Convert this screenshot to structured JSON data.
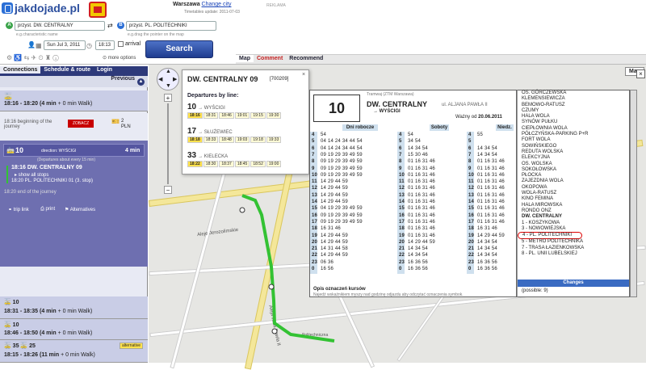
{
  "header": {
    "logo": "jakdojade.pl",
    "city_label": "Warszawa",
    "city_link": "Change city",
    "timetable_update": "Timetables update: 2011-07-03",
    "reklama": "REKLAMA",
    "from_value": "przyst. DW. CENTRALNY",
    "from_hint": "e.g.characteristic name",
    "to_value": "przyst. PL. POLITECHNIKI",
    "to_hint": "e.g.drag the pointer on the map",
    "date": "Sun Jul 3, 2011",
    "time": "18:13",
    "arrival": "arrival",
    "more_options": "more options",
    "search": "Search"
  },
  "mapbar": {
    "tabs": [
      "Map",
      "Comment",
      "Recommend"
    ],
    "map_btn": "Map"
  },
  "sidebar": {
    "tabs": [
      "Connections",
      "Schedule & route",
      "Login"
    ],
    "previous": "Previous",
    "first": {
      "time": "18:16 - 18:20",
      "dur": "(4 min",
      "walk": "+ 0 min Walk)"
    },
    "begin": "18:16 beginning of the journey",
    "badge": "ZOBACZ",
    "price": "2",
    "currency": "PLN",
    "line": "10",
    "direction": "direction: WYŚCIGI",
    "freq": "(Departures about every 15 min)",
    "dur": "4 min",
    "stop1": "18:16 DW. CENTRALNY 09",
    "show_stops": "show all stops",
    "stop2": "18:20 PL. POLITECHNIKI 01 (3. stop)",
    "end": "18:20 end of the journey",
    "trip_link": "trip link",
    "print": "print",
    "alternatives": "Alternatives",
    "alts": [
      {
        "line": "10",
        "time": "18:31 - 18:35",
        "dur": "(4 min",
        "walk": "+ 0 min Walk)"
      },
      {
        "line": "10",
        "time": "18:46 - 18:50",
        "dur": "(4 min",
        "walk": "+ 0 min Walk)"
      },
      {
        "line": "35",
        "line2": "25",
        "time": "18:15 - 18:26",
        "dur": "(11 min",
        "walk": "+ 0 min Walk)",
        "tag": "alternative"
      }
    ]
  },
  "popup": {
    "stop": "DW. CENTRALNY 09",
    "code": "[700209]",
    "heading": "Departures by line:",
    "show": "Show full",
    "rows": [
      {
        "line": "10",
        "dir": "WYŚCIGI",
        "times": [
          "18:16",
          "18:31",
          "18:46",
          "19:01",
          "19:15",
          "19:30"
        ]
      },
      {
        "line": "17",
        "dir": "SŁUŻEWIEC",
        "times": [
          "18:18",
          "18:33",
          "18:48",
          "19:03",
          "19:18",
          "19:33"
        ]
      },
      {
        "line": "33",
        "dir": "KIELECKA",
        "times": [
          "18:22",
          "18:30",
          "18:37",
          "18:45",
          "18:52",
          "19:00"
        ]
      }
    ]
  },
  "timetable": {
    "operator": "Tramwaj (ZTM Warszawa)",
    "line": "10",
    "stop": "DW. CENTRALNY",
    "street": "ul. ALJANA PAWŁA II",
    "dir": "WYŚCIGI",
    "valid": "Ważny od",
    "valid_date": "20.06.2011",
    "headers": [
      "Dni robocze",
      "Soboty",
      "Niedz."
    ],
    "hours": [
      "4",
      "5",
      "6",
      "7",
      "8",
      "9",
      "10",
      "11",
      "12",
      "13",
      "14",
      "15",
      "16",
      "17",
      "18",
      "19",
      "20",
      "21",
      "22",
      "23",
      "0"
    ],
    "wk": [
      "54",
      "04 14 24 34 44 54",
      "04 14 24 34 44 54",
      "09 19 29 39 49 59",
      "09 19 29 39 49 59",
      "09 19 29 39 49 59",
      "09 19 29 39 49 59",
      "14 29 44 59",
      "14 29 44 59",
      "14 29 44 59",
      "14 29 44 59",
      "04 19 29 39 49 59",
      "09 19 29 39 49 59",
      "09 19 29 39 49 59",
      "16 31 46",
      "14 29 44 59",
      "14 29 44 59",
      "14 31 44 58",
      "14 29 44 59",
      "06 36",
      "16 56"
    ],
    "sat": [
      "54",
      "34 54",
      "14 34 54",
      "15 30 46",
      "01 16 31 46",
      "01 16 31 46",
      "01 16 31 46",
      "01 16 31 46",
      "01 16 31 46",
      "01 16 31 46",
      "01 16 31 46",
      "01 16 31 46",
      "01 16 31 46",
      "01 16 31 46",
      "01 16 31 46",
      "01 16 31 46",
      "14 29 44 59",
      "14 34 54",
      "14 34 54",
      "16 36 56",
      "16 36 56"
    ],
    "sun": [
      "55",
      "",
      "14 34 54",
      "14 34 54",
      "01 16 31 46",
      "01 16 31 46",
      "01 16 31 46",
      "01 16 31 46",
      "01 16 31 46",
      "01 16 31 46",
      "01 16 31 46",
      "01 16 31 46",
      "01 16 31 46",
      "01 16 31 46",
      "16 31 46",
      "14 29 44 59",
      "14 34 54",
      "14 34 54",
      "14 34 54",
      "16 36 56",
      "16 36 56"
    ],
    "notes_title": "Opis oznaczeń kursów",
    "notes_text": "Najedź wskaźnikiem myszy nad godzinę odjazdu aby odczytać oznaczenia symbok."
  },
  "stops": {
    "items": [
      "OS. GÓRCZEWSKA",
      "KLEMENSIEWICZA",
      "BEMOWO-RATUSZ",
      "CZUMY",
      "HALA WOLA",
      "SYNÓW PUŁKU",
      "CIEPŁOWNIA WOLA",
      "PÓŁCZYŃSKA-PARKING P+R",
      "FORT WOLA",
      "SOWIŃSKIEGO",
      "REDUTA WOLSKA",
      "ELEKCYJNA",
      "OS. WOLSKA",
      "SOKOŁOWSKA",
      "PŁOCKA",
      "ZAJEZDNIA WOLA",
      "OKOPOWA",
      "WOLA-RATUSZ",
      "KINO FEMINA",
      "HALA MIROWSKA",
      "RONDO ONZ",
      "DW. CENTRALNY",
      "1 - KOSZYKOWA",
      "3 - NOWOWIEJSKA",
      "4 - PL. POLITECHNIKI",
      "5 - METRO POLITECHNIKA",
      "7 - TRASA ŁAZIENKOWSKA",
      "8 - PL. UNII LUBELSKIEJ"
    ],
    "changes": "Changes",
    "possible": "(possible: 9)"
  },
  "map": {
    "street1": "Aleje Jerozolimskie",
    "street2": "Aleja Jana Pawła II",
    "street3": "Politechniczna",
    "label_b": "B"
  },
  "colors": {
    "navy": "#2e3a7a",
    "route": "#33c233",
    "yellow": "#ffe14d"
  }
}
